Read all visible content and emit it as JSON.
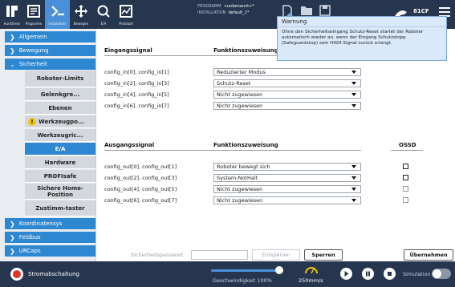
{
  "topbar": {
    "buttons": [
      {
        "label": "Ausführen",
        "icon": "run-icon"
      },
      {
        "label": "Programm",
        "icon": "program-icon"
      },
      {
        "label": "Installation",
        "icon": "installation-icon"
      },
      {
        "label": "Bewegen",
        "icon": "move-icon"
      },
      {
        "label": "E/A",
        "icon": "io-icon"
      },
      {
        "label": "Protokoll",
        "icon": "log-icon"
      }
    ],
    "program_label": "PROGRAMM",
    "program_value": "<unbenannt>*",
    "installation_label": "INSTALLATION",
    "installation_value": "default_1*",
    "robot_id": "81CF"
  },
  "sidebar": {
    "items": [
      {
        "label": "Allgemein",
        "type": "category",
        "chevron": "right"
      },
      {
        "label": "Bewegung",
        "type": "category",
        "chevron": "right"
      },
      {
        "label": "Sicherheit",
        "type": "category",
        "chevron": "down"
      },
      {
        "label": "Roboter-Limits",
        "type": "sub"
      },
      {
        "label": "Gelenkgre...",
        "type": "sub"
      },
      {
        "label": "Ebenen",
        "type": "sub"
      },
      {
        "label": "Werkzeugpo...",
        "type": "sub",
        "warning": true
      },
      {
        "label": "Werkzeugric...",
        "type": "sub"
      },
      {
        "label": "E/A",
        "type": "sub",
        "active": true
      },
      {
        "label": "Hardware",
        "type": "sub"
      },
      {
        "label": "PROFIsafe",
        "type": "sub"
      },
      {
        "label": "Sichere Home-Position",
        "type": "sub"
      },
      {
        "label": "Zustimm-taster",
        "type": "sub"
      },
      {
        "label": "Koordinatensys",
        "type": "category",
        "chevron": "right"
      },
      {
        "label": "Feldbus",
        "type": "category",
        "chevron": "right"
      },
      {
        "label": "URCaps",
        "type": "category",
        "chevron": "right"
      }
    ]
  },
  "inputs": {
    "header_signal": "Eingangssignal",
    "header_function": "Funktionszuweisung",
    "rows": [
      {
        "signal": "config_in[0], config_in[1]",
        "function": "Reduzierter Modus"
      },
      {
        "signal": "config_in[2], config_in[3]",
        "function": "Schutz-Reset"
      },
      {
        "signal": "config_in[4], config_in[5]",
        "function": "Nicht zugewiesen"
      },
      {
        "signal": "config_in[6], config_in[7]",
        "function": "Nicht zugewiesen"
      }
    ]
  },
  "outputs": {
    "header_signal": "Ausgangssignal",
    "header_function": "Funktionszuweisung",
    "header_ossd": "OSSD",
    "rows": [
      {
        "signal": "config_out[0], config_out[1]",
        "function": "Roboter bewegt sich",
        "ossd": false
      },
      {
        "signal": "config_out[2], config_out[3]",
        "function": "System-NotHalt",
        "ossd": false
      },
      {
        "signal": "config_out[4], config_out[5]",
        "function": "Nicht zugewiesen",
        "ossd": false
      },
      {
        "signal": "config_out[6], config_out[7]",
        "function": "Nicht zugewiesen",
        "ossd": false
      }
    ]
  },
  "tooltip": {
    "title": "Warnung",
    "text": "Ohne den Sicherheitseingang Schutz-Reset startet der Roboter automatisch wieder an, wenn der Eingang Schutzstopp (Safeguardstop) sein HIGH-Signal zurück erlangt."
  },
  "password": {
    "label": "Sicherheitspasswort",
    "value": "",
    "unlock_label": "Entsperren",
    "lock_label": "Sperren",
    "apply_label": "Übernehmen"
  },
  "footer": {
    "power_label": "Stromabschaltung",
    "speed_label": "Geschwindigkeit 100%",
    "speed_value": 1.0,
    "movement_value": "250mm/s",
    "simulation_label": "Simulation",
    "simulation_on": false
  },
  "colors": {
    "topbar": "#26364f",
    "accent": "#2e88d1",
    "power": "#e0342a",
    "warning": "#f1c40f"
  }
}
